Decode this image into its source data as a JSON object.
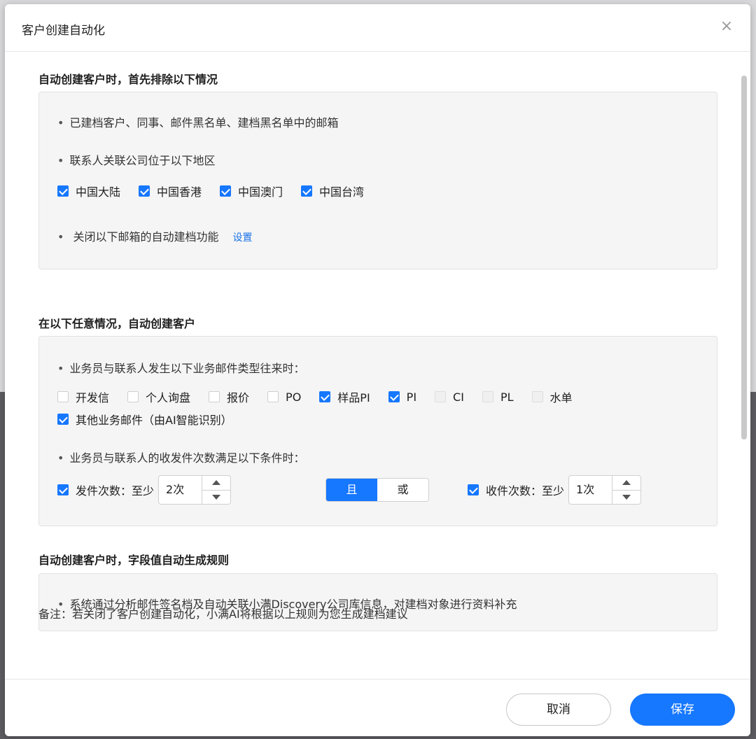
{
  "dialog": {
    "title": "客户创建自动化",
    "close_label": "×"
  },
  "exclusion": {
    "title": "自动创建客户时，首先排除以下情况",
    "item1": "已建档客户、同事、邮件黑名单、建档黑名单中的邮箱",
    "item2": "联系人关联公司位于以下地区",
    "regions": [
      {
        "label": "中国大陆",
        "checked": true
      },
      {
        "label": "中国香港",
        "checked": true
      },
      {
        "label": "中国澳门",
        "checked": true
      },
      {
        "label": "中国台湾",
        "checked": true
      }
    ],
    "item3": "关闭以下邮箱的自动建档功能",
    "settings_link": "设置"
  },
  "auto_create": {
    "title": "在以下任意情况，自动创建客户",
    "item1": "业务员与联系人发生以下业务邮件类型往来时：",
    "mail_types": [
      {
        "label": "开发信",
        "state": "unchecked"
      },
      {
        "label": "个人询盘",
        "state": "unchecked"
      },
      {
        "label": "报价",
        "state": "unchecked"
      },
      {
        "label": "PO",
        "state": "unchecked"
      },
      {
        "label": "样品PI",
        "state": "checked"
      },
      {
        "label": "PI",
        "state": "checked"
      },
      {
        "label": "CI",
        "state": "disabled"
      },
      {
        "label": "PL",
        "state": "disabled"
      },
      {
        "label": "水单",
        "state": "disabled"
      }
    ],
    "other_mail": {
      "label": "其他业务邮件（由AI智能识别）",
      "state": "checked"
    },
    "item2": "业务员与联系人的收发件次数满足以下条件时：",
    "send_count": {
      "label": "发件次数：至少",
      "value": "2次",
      "checked": true
    },
    "logic": {
      "and": "且",
      "or": "或",
      "selected": "and"
    },
    "recv_count": {
      "label": "收件次数：至少",
      "value": "1次",
      "checked": true
    }
  },
  "field_rules": {
    "title": "自动创建客户时，字段值自动生成规则",
    "item1": "系统通过分析邮件签名档及自动关联小满Discovery公司库信息，对建档对象进行资料补充"
  },
  "note": "备注：若关闭了客户创建自动化，小满AI将根据以上规则为您生成建档建议",
  "footer": {
    "cancel": "取消",
    "save": "保存"
  },
  "colors": {
    "accent": "#1677ff",
    "panel_bg": "#f5f5f5",
    "link": "#1a73e8"
  }
}
